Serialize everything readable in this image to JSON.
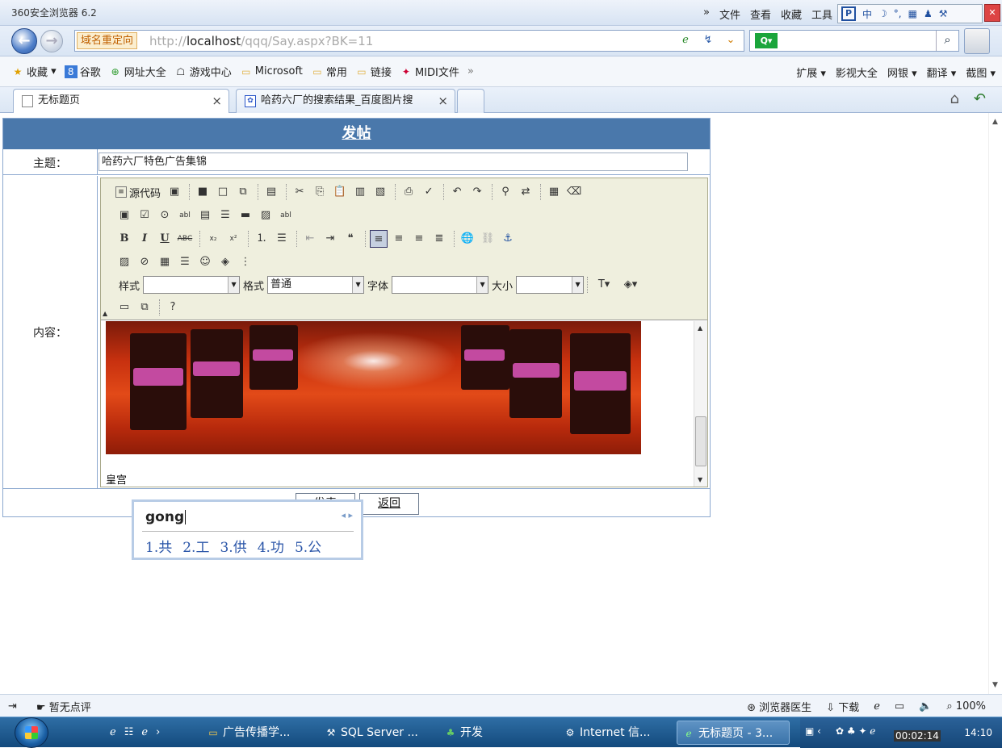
{
  "browser": {
    "title": "360安全浏览器 6.2",
    "menus": [
      "»",
      "文件",
      "查看",
      "收藏",
      "工具"
    ],
    "redirect_label": "域名重定向",
    "url_prefix": "http://",
    "url_host": "localhost",
    "url_path": "/qqq/Say.aspx?BK=11",
    "ime_bar_label": "中"
  },
  "favorites": {
    "items": [
      {
        "label": "收藏",
        "icon": "star-icon",
        "dropdown": true
      },
      {
        "label": "谷歌",
        "icon": "google-icon"
      },
      {
        "label": "网址大全",
        "icon": "plus-globe-icon"
      },
      {
        "label": "游戏中心",
        "icon": "gamepad-icon"
      },
      {
        "label": "Microsoft",
        "icon": "folder-icon"
      },
      {
        "label": "常用",
        "icon": "folder-icon"
      },
      {
        "label": "链接",
        "icon": "folder-icon"
      },
      {
        "label": "MIDI文件",
        "icon": "midi-icon"
      }
    ],
    "more": "»",
    "right_items": [
      "扩展",
      "影视大全",
      "网银",
      "翻译",
      "截图"
    ]
  },
  "tabs": [
    {
      "label": "无标题页",
      "close": "×"
    },
    {
      "label": "哈药六厂的搜索结果_百度图片搜",
      "close": "×"
    }
  ],
  "form": {
    "header": "发帖",
    "subject_label": "主题：",
    "subject_value": "哈药六厂特色广告集锦",
    "content_label": "内容：",
    "source_label": "源代码",
    "style_label": "样式",
    "format_label": "格式",
    "format_value": "普通",
    "font_label": "字体",
    "size_label": "大小",
    "caption": "皇宫",
    "submit_label": "发表",
    "back_label": "返回"
  },
  "ime": {
    "pinyin": "gong",
    "candidates": [
      "1.共",
      "2.工",
      "3.供",
      "4.功",
      "5.公"
    ]
  },
  "status": {
    "left_text": "暂无点评",
    "right_items": [
      "浏览器医生",
      "下载",
      "100%"
    ]
  },
  "taskbar": {
    "tasks": [
      {
        "label": "广告传播学..."
      },
      {
        "label": "SQL Server ..."
      },
      {
        "label": "开发"
      },
      {
        "label": "Internet 信..."
      },
      {
        "label": "无标题页 - 3..."
      }
    ],
    "timer": "00:02:14",
    "clock": "14:10"
  }
}
